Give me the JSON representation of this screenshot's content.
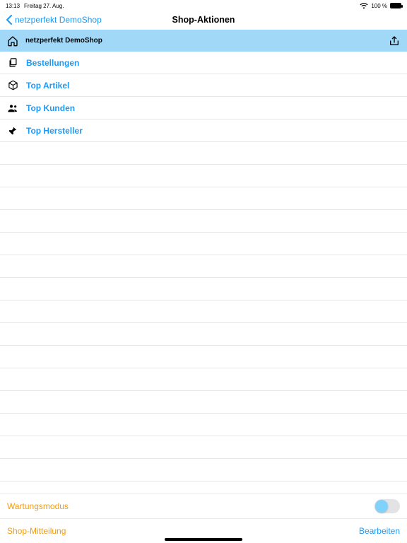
{
  "status": {
    "time": "13:13",
    "date": "Freitag 27. Aug.",
    "battery": "100 %"
  },
  "nav": {
    "back": "netzperfekt DemoShop",
    "title": "Shop-Aktionen"
  },
  "section": {
    "title": "netzperfekt DemoShop"
  },
  "menu": [
    {
      "key": "orders",
      "label": "Bestellungen"
    },
    {
      "key": "articles",
      "label": "Top Artikel"
    },
    {
      "key": "customers",
      "label": "Top Kunden"
    },
    {
      "key": "brands",
      "label": "Top Hersteller"
    }
  ],
  "footer": {
    "maintenance": "Wartungsmodus",
    "message": "Shop-Mitteilung",
    "edit": "Bearbeiten"
  }
}
